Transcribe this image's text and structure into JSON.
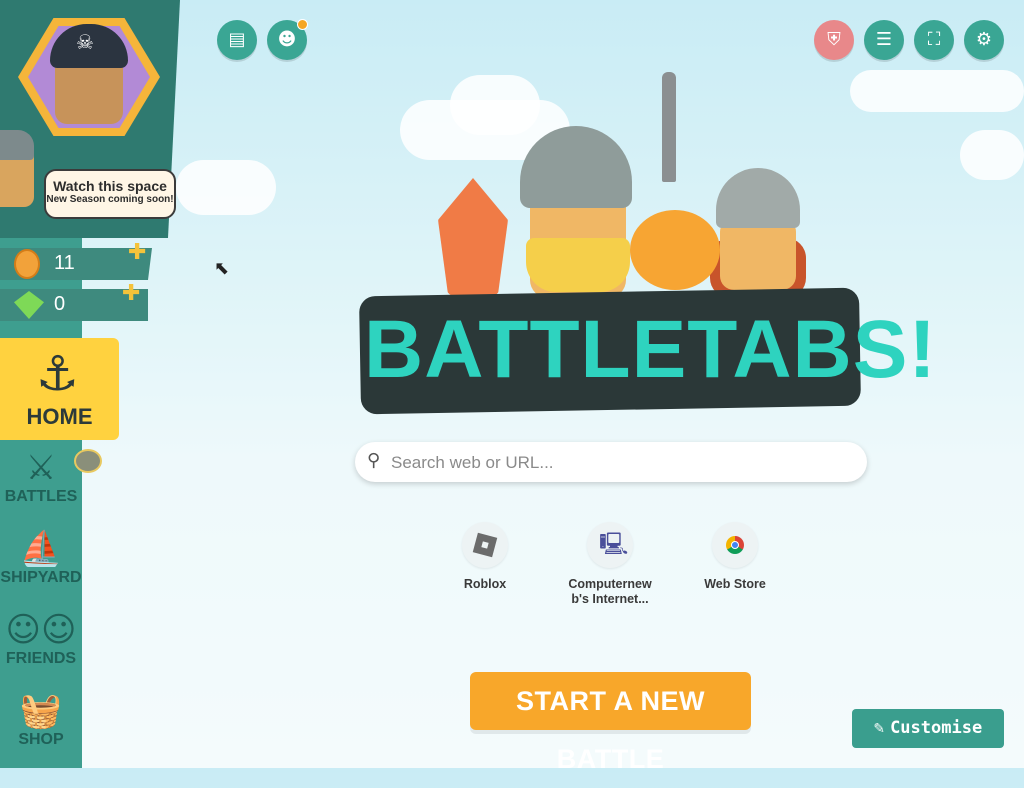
{
  "colors": {
    "sidebar_dark": "#2f7a70",
    "sidebar": "#3e9e8f",
    "home_active": "#ffd23f",
    "accent_teal": "#3aa694",
    "start_orange": "#f8a72a",
    "logo_teal": "#2ed3bf"
  },
  "promo": {
    "line1": "Watch this space",
    "line2": "New Season coming soon!"
  },
  "currency": {
    "coins": "11",
    "gems": "0"
  },
  "nav": {
    "home": "HOME",
    "battles": "BATTLES",
    "shipyard": "SHIPYARD",
    "friends": "FRIENDS",
    "shop": "SHOP"
  },
  "top_buttons_left": [
    "news-icon",
    "discord-icon"
  ],
  "top_buttons_right": [
    "shield-icon",
    "list-icon",
    "fullscreen-icon",
    "settings-icon"
  ],
  "logo_text": "BATTLETABS!",
  "search": {
    "placeholder": "Search web or URL..."
  },
  "shortcuts": [
    {
      "label": "Roblox",
      "icon": "roblox-icon"
    },
    {
      "label": "Computernew b's Internet...",
      "icon": "computer-icon"
    },
    {
      "label": "Web Store",
      "icon": "chrome-webstore-icon"
    }
  ],
  "start_button": "START A NEW BATTLE",
  "customise_button": "Customise"
}
